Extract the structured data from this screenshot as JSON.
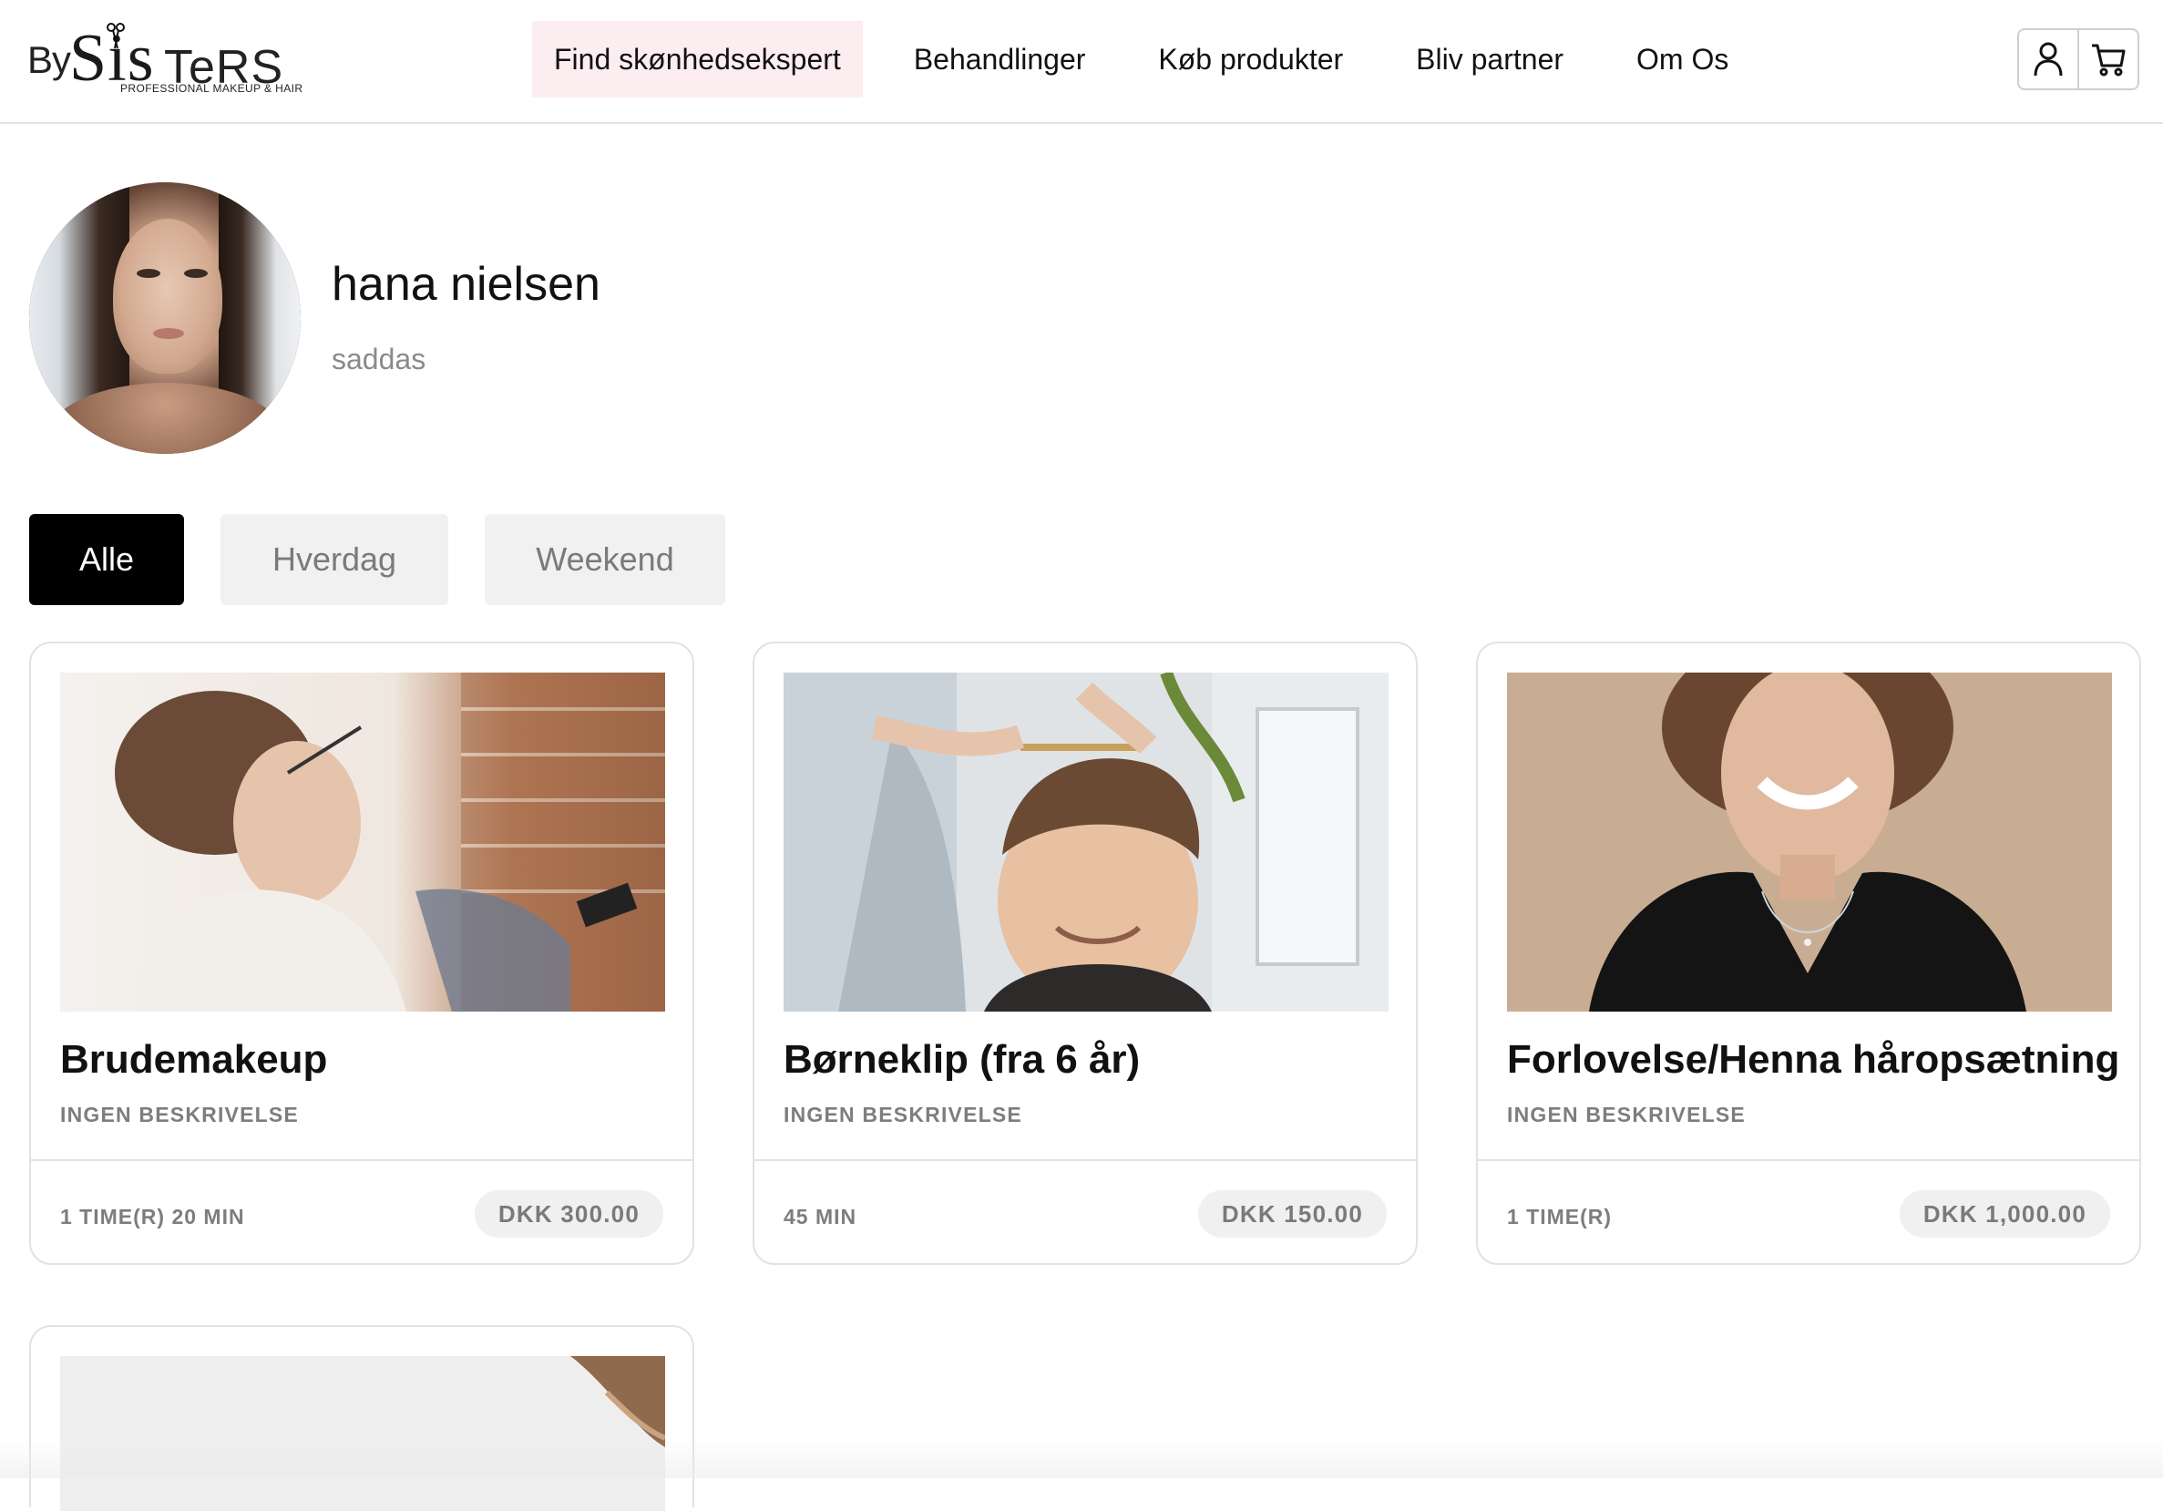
{
  "brand": {
    "name_prefix": "By",
    "name_main_a": "Sis",
    "name_main_b": "TeRS",
    "tagline": "PROFESSIONAL MAKEUP & HAIR"
  },
  "nav": {
    "items": [
      {
        "label": "Find skønhedsekspert",
        "active": true
      },
      {
        "label": "Behandlinger"
      },
      {
        "label": "Køb produkter"
      },
      {
        "label": "Bliv partner"
      },
      {
        "label": "Om Os"
      }
    ],
    "icons": [
      "user-icon",
      "cart-icon"
    ]
  },
  "profile": {
    "name": "hana nielsen",
    "subtitle": "saddas"
  },
  "filters": [
    {
      "label": "Alle",
      "active": true
    },
    {
      "label": "Hverdag"
    },
    {
      "label": "Weekend"
    }
  ],
  "services": [
    {
      "title": "Brudemakeup",
      "description": "INGEN BESKRIVELSE",
      "duration": "1 TIME(R) 20 MIN",
      "price": "DKK 300.00"
    },
    {
      "title": "Børneklip (fra 6 år)",
      "description": "INGEN BESKRIVELSE",
      "duration": "45 MIN",
      "price": "DKK 150.00"
    },
    {
      "title": "Forlovelse/Henna håropsætning",
      "description": "INGEN BESKRIVELSE",
      "duration": "1 TIME(R)",
      "price": "DKK 1,000.00"
    }
  ],
  "colors": {
    "accent_active_nav_bg": "#fcedf1",
    "filter_active_bg": "#000000",
    "filter_inactive_bg": "#f1f1f1",
    "price_pill_bg": "#f0f0f0"
  }
}
